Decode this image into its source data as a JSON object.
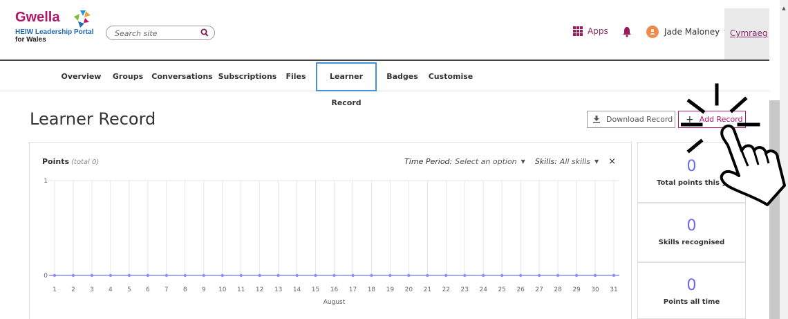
{
  "header": {
    "logo_name": "Gwella",
    "logo_line1": "HEIW Leadership Portal",
    "logo_line2": "for Wales",
    "search_placeholder": "Search site",
    "apps_label": "Apps",
    "user_name": "Jade Maloney",
    "language_link": "Cymraeg"
  },
  "tabs": [
    "Overview",
    "Groups",
    "Conversations",
    "Subscriptions",
    "Files",
    "Learner Record",
    "Badges",
    "Customise"
  ],
  "active_tab": "Learner Record",
  "page": {
    "title": "Learner Record",
    "download_label": "Download Record",
    "add_label": "Add Record"
  },
  "chart_panel": {
    "title": "Points",
    "subtitle": "(total 0)",
    "time_period_label": "Time Period:",
    "time_period_value": "Select an option",
    "skills_label": "Skills:",
    "skills_value": "All skills",
    "close_glyph": "×"
  },
  "stats": [
    {
      "value": "0",
      "label": "Total points this y"
    },
    {
      "value": "0",
      "label": "Skills recognised"
    },
    {
      "value": "0",
      "label": "Points all time"
    }
  ],
  "chart_data": {
    "type": "line",
    "x": [
      1,
      2,
      3,
      4,
      5,
      6,
      7,
      8,
      9,
      10,
      11,
      12,
      13,
      14,
      15,
      16,
      17,
      18,
      19,
      20,
      21,
      22,
      23,
      24,
      25,
      26,
      27,
      28,
      29,
      30,
      31
    ],
    "series": [
      {
        "values": [
          0,
          0,
          0,
          0,
          0,
          0,
          0,
          0,
          0,
          0,
          0,
          0,
          0,
          0,
          0,
          0,
          0,
          0,
          0,
          0,
          0,
          0,
          0,
          0,
          0,
          0,
          0,
          0,
          0,
          0,
          0
        ]
      }
    ],
    "xlabel": "August",
    "ylabel": "",
    "ylim": [
      0,
      1
    ],
    "yticks": [
      "0",
      "1"
    ],
    "grid": true,
    "line_color": "#8e8ef0"
  },
  "colors": {
    "brand": "#b0176a",
    "accent": "#6a6ae8",
    "active_tab_border": "#4a90d9"
  }
}
